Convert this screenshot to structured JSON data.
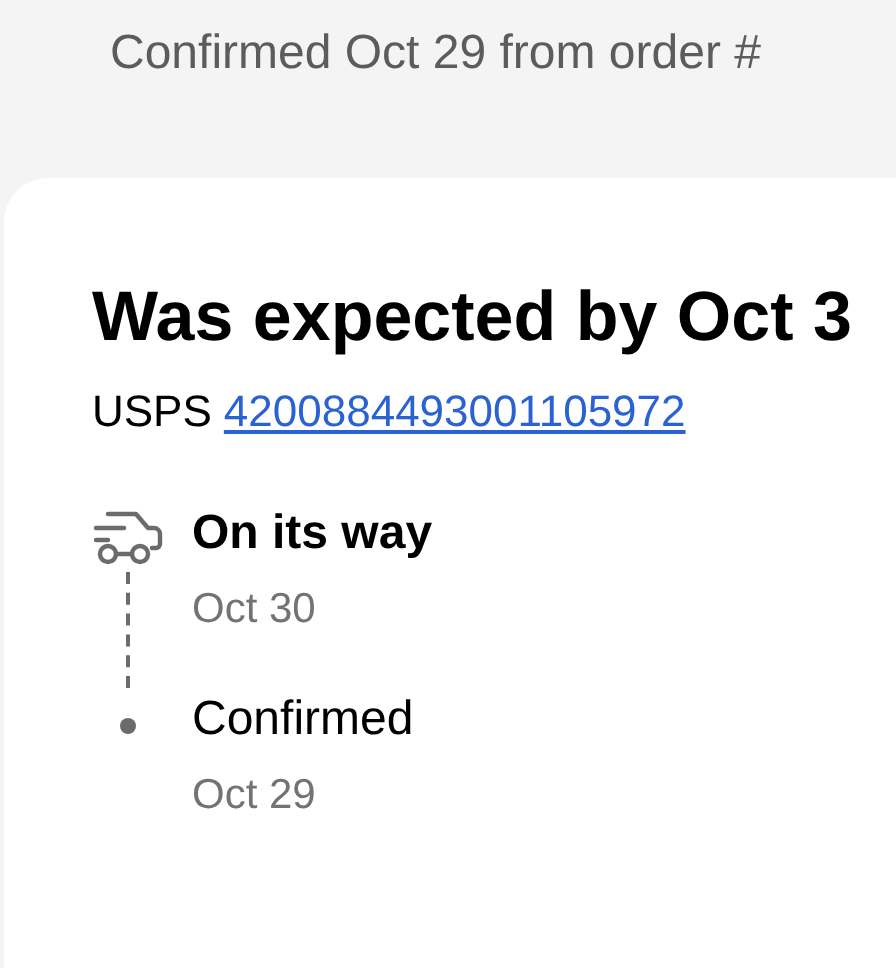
{
  "subtitle": "Confirmed Oct 29 from order #",
  "card": {
    "heading": "Was expected by Oct 3",
    "carrier": "USPS",
    "tracking_number": "4200884493001105972",
    "steps": [
      {
        "label": "On its way",
        "date": "Oct 30",
        "current": true
      },
      {
        "label": "Confirmed",
        "date": "Oct 29",
        "current": false
      }
    ]
  }
}
